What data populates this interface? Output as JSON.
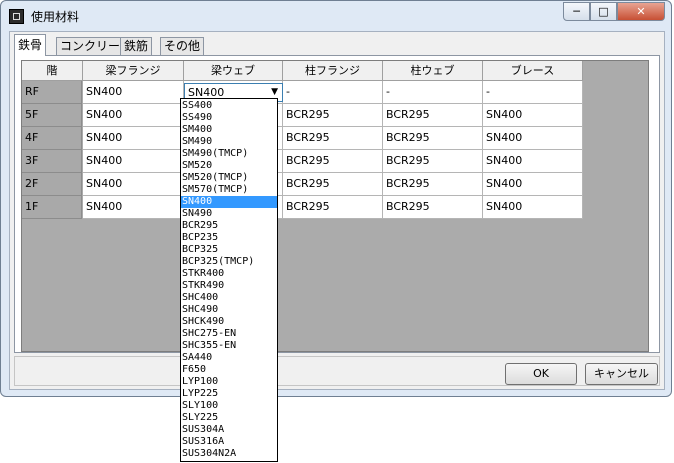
{
  "window": {
    "title": "使用材料",
    "minimize": "─",
    "maximize": "□",
    "close": "✕"
  },
  "tabs": [
    "鉄骨",
    "コンクリート",
    "鉄筋",
    "その他"
  ],
  "grid": {
    "columns": [
      "階",
      "梁フランジ",
      "梁ウェブ",
      "柱フランジ",
      "柱ウェブ",
      "ブレース"
    ],
    "rows": [
      {
        "floor": "RF",
        "cells": [
          "SN400",
          "SN400",
          "-",
          "-",
          "-"
        ]
      },
      {
        "floor": "5F",
        "cells": [
          "SN400",
          "",
          "BCR295",
          "BCR295",
          "SN400"
        ]
      },
      {
        "floor": "4F",
        "cells": [
          "SN400",
          "",
          "BCR295",
          "BCR295",
          "SN400"
        ]
      },
      {
        "floor": "3F",
        "cells": [
          "SN400",
          "",
          "BCR295",
          "BCR295",
          "SN400"
        ]
      },
      {
        "floor": "2F",
        "cells": [
          "SN400",
          "",
          "BCR295",
          "BCR295",
          "SN400"
        ]
      },
      {
        "floor": "1F",
        "cells": [
          "SN400",
          "",
          "BCR295",
          "BCR295",
          "SN400"
        ]
      }
    ]
  },
  "combo": {
    "value": "SN400",
    "arrow": "▼"
  },
  "dropdown": {
    "selected": "SN400",
    "options": [
      "SS400",
      "SS490",
      "SM400",
      "SM490",
      "SM490(TMCP)",
      "SM520",
      "SM520(TMCP)",
      "SM570(TMCP)",
      "SN400",
      "SN490",
      "BCR295",
      "BCP235",
      "BCP325",
      "BCP325(TMCP)",
      "STKR400",
      "STKR490",
      "SHC400",
      "SHC490",
      "SHCK490",
      "SHC275-EN",
      "SHC355-EN",
      "SA440",
      "F650",
      "LYP100",
      "LYP225",
      "SLY100",
      "SLY225",
      "SUS304A",
      "SUS316A",
      "SUS304N2A"
    ]
  },
  "buttons": {
    "ok": "OK",
    "cancel": "キャンセル"
  }
}
